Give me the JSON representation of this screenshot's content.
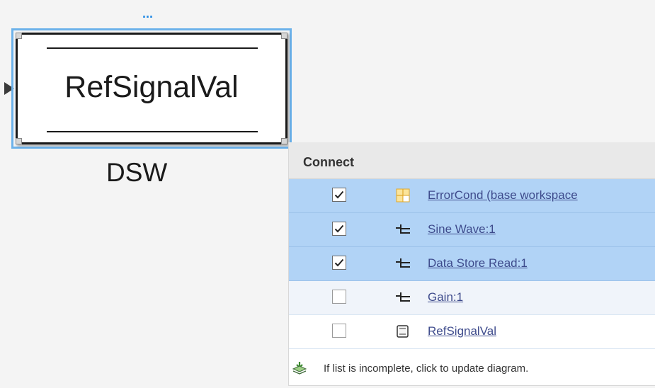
{
  "canvas": {
    "more_dots": "...",
    "block": {
      "name": "RefSignalVal",
      "label": "DSW"
    }
  },
  "connect_popup": {
    "title": "Connect",
    "items": [
      {
        "checked": true,
        "icon": "data-store-grid-icon",
        "label": "ErrorCond (base workspace"
      },
      {
        "checked": true,
        "icon": "signal-port-icon",
        "label": "Sine Wave:1"
      },
      {
        "checked": true,
        "icon": "signal-port-icon",
        "label": "Data Store Read:1"
      },
      {
        "checked": false,
        "icon": "signal-port-icon",
        "label": "Gain:1"
      },
      {
        "checked": false,
        "icon": "block-icon",
        "label": "RefSignalVal"
      }
    ],
    "footer": {
      "icon": "update-diagram-icon",
      "text": "If list is incomplete, click to update diagram."
    }
  },
  "colors": {
    "selection_border": "#6cb2ea",
    "row_selected": "#b1d3f6",
    "link": "#3e4b8c",
    "dots": "#1e88e5"
  }
}
